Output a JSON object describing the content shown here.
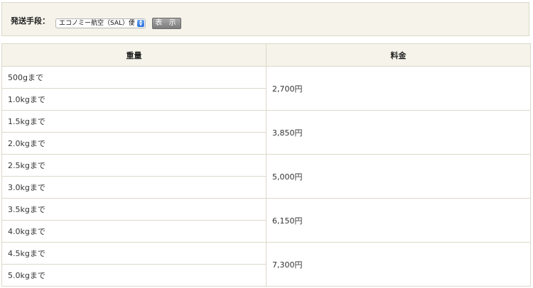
{
  "shipping": {
    "label": "発送手段：",
    "method_selected": "エコノミー航空（SAL）便",
    "show_button": "表 示"
  },
  "table": {
    "headers": [
      "重量",
      "料金"
    ],
    "weights": [
      "500gまで",
      "1.0kgまで",
      "1.5kgまで",
      "2.0kgまで",
      "2.5kgまで",
      "3.0kgまで",
      "3.5kgまで",
      "4.0kgまで",
      "4.5kgまで",
      "5.0kgまで"
    ],
    "prices": [
      "2,700円",
      "3,850円",
      "5,000円",
      "6,150円",
      "7,300円"
    ]
  },
  "colors": {
    "header_bg": "#f5f3ea",
    "border": "#dcd8c8",
    "select_arrow": "#2c6fd8",
    "button": "#8e8e8e"
  },
  "icons": {
    "select_arrows": "updown-arrows-icon"
  }
}
